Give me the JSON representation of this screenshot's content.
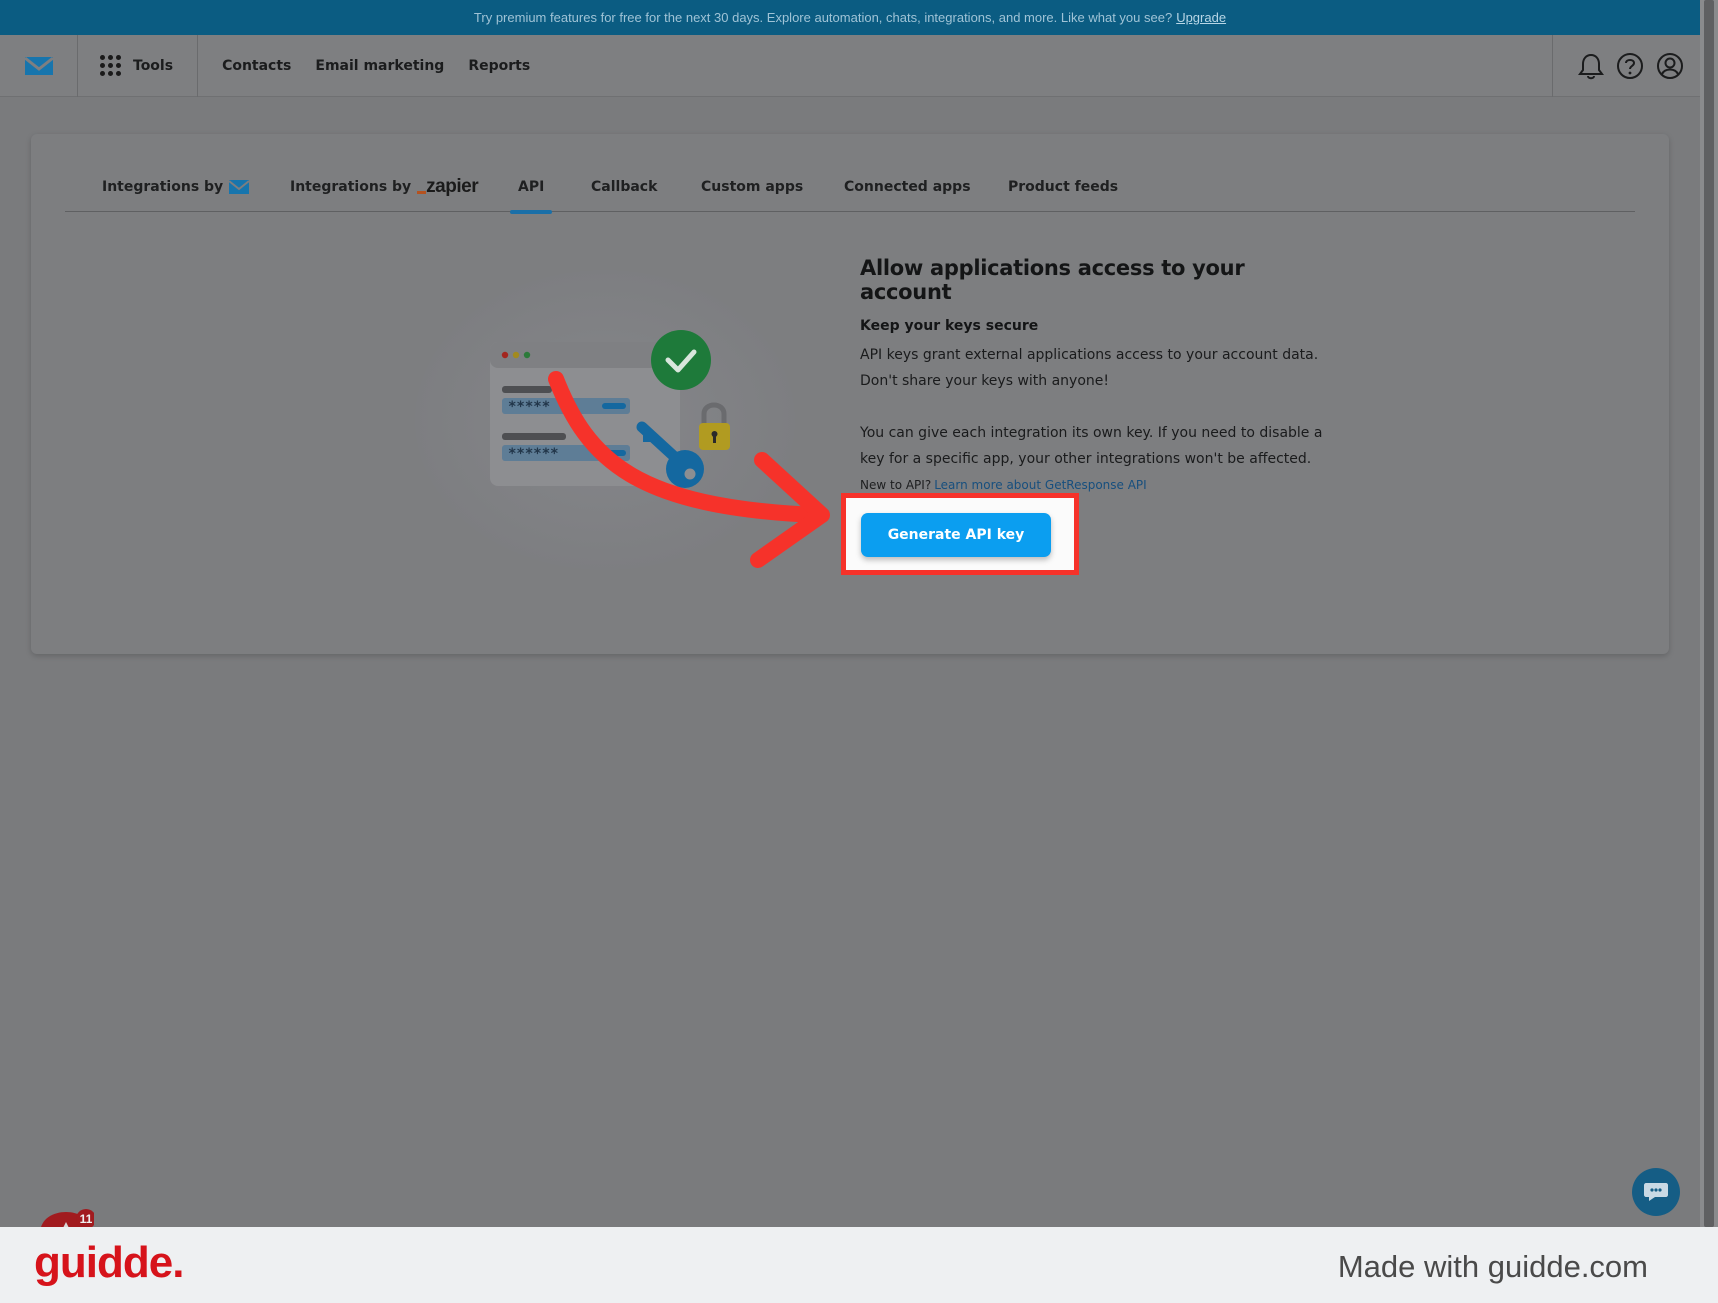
{
  "promo": {
    "text": "Try premium features for free for the next 30 days. Explore automation, chats, integrations, and more. Like what you see?",
    "link": "Upgrade"
  },
  "nav": {
    "logo_icon": "envelope-logo-icon",
    "tools_label": "Tools",
    "links": [
      "Contacts",
      "Email marketing",
      "Reports"
    ],
    "right_icons": [
      "bell-icon",
      "help-icon",
      "account-icon"
    ]
  },
  "tabs": {
    "integrations_by": "Integrations by",
    "integrations_by_zapier": "Integrations by",
    "zapier_logo": "zapier",
    "api": "API",
    "callback": "Callback",
    "custom_apps": "Custom apps",
    "connected_apps": "Connected apps",
    "product_feeds": "Product feeds",
    "active": "API"
  },
  "illustration": {
    "password_masks": [
      "*****",
      "******"
    ]
  },
  "api_panel": {
    "heading": "Allow applications access to your account",
    "subheading": "Keep your keys secure",
    "para1": "API keys grant external applications access to your account data. Don't share your keys with anyone!",
    "para2": "You can give each integration its own key. If you need to disable a key for a specific app, your other integrations won't be affected.",
    "new_to_api": "New to API?",
    "learn_more": "Learn more about GetResponse API",
    "button": "Generate API key"
  },
  "widgets": {
    "notification_count": "11",
    "chat_icon": "chat-bubble-icon"
  },
  "footer": {
    "brand": "guidde.",
    "made_with": "Made with guidde.com"
  },
  "colors": {
    "accent": "#0b9ef0",
    "highlight": "#f6322a",
    "promo_bg": "#0b5c82",
    "brand_red": "#d6131b"
  }
}
